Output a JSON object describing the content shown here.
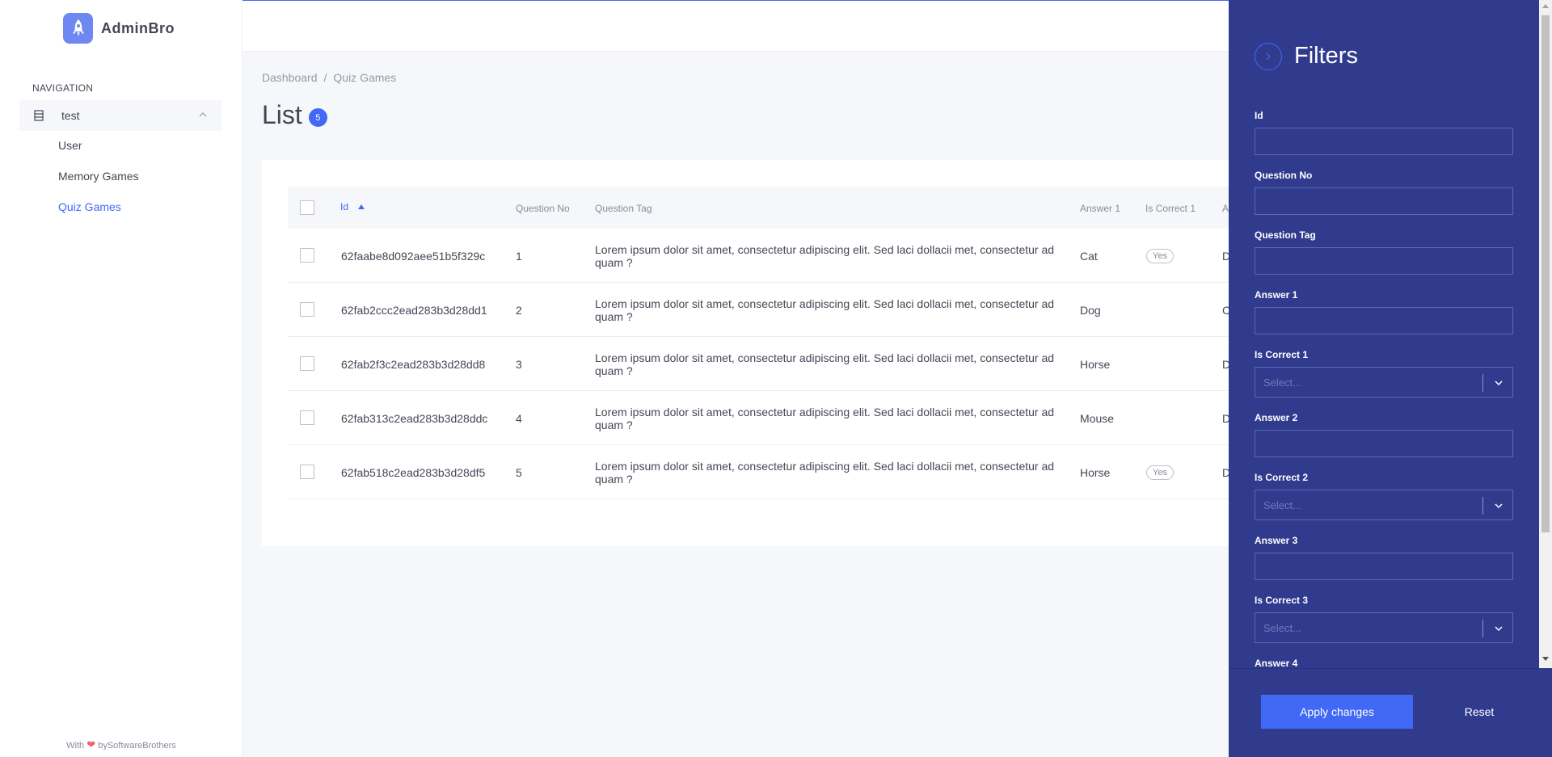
{
  "brand": {
    "name": "AdminBro",
    "logo_icon": "rocket-icon",
    "accent": "#4268F6"
  },
  "sidebar": {
    "heading": "NAVIGATION",
    "parent": {
      "label": "test",
      "icon": "database-icon"
    },
    "items": [
      {
        "label": "User",
        "active": false
      },
      {
        "label": "Memory Games",
        "active": false
      },
      {
        "label": "Quiz Games",
        "active": true
      }
    ],
    "footer": {
      "prefix": "With",
      "heart": "❤",
      "suffix": "bySoftwareBrothers"
    }
  },
  "breadcrumb": {
    "items": [
      "Dashboard",
      "Quiz Games"
    ],
    "separator": "/"
  },
  "page": {
    "title": "List",
    "count": "5"
  },
  "table": {
    "columns": [
      "Id",
      "Question No",
      "Question Tag",
      "Answer 1",
      "Is Correct 1",
      "A"
    ],
    "sort": {
      "column": "Id",
      "direction": "asc"
    },
    "rows": [
      {
        "id": "62faabe8d092aee51b5f329c",
        "question_no": "1",
        "question_tag": "Lorem ipsum dolor sit amet, consectetur adipiscing elit. Sed laci dollacii met, consectetur ad quam ?",
        "answer_1": "Cat",
        "is_correct_1": "Yes",
        "answer_2_partial": "D"
      },
      {
        "id": "62fab2ccc2ead283b3d28dd1",
        "question_no": "2",
        "question_tag": "Lorem ipsum dolor sit amet, consectetur adipiscing elit. Sed laci dollacii met, consectetur ad quam ?",
        "answer_1": "Dog",
        "is_correct_1": "",
        "answer_2_partial": "C"
      },
      {
        "id": "62fab2f3c2ead283b3d28dd8",
        "question_no": "3",
        "question_tag": "Lorem ipsum dolor sit amet, consectetur adipiscing elit. Sed laci dollacii met, consectetur ad quam ?",
        "answer_1": "Horse",
        "is_correct_1": "",
        "answer_2_partial": "D"
      },
      {
        "id": "62fab313c2ead283b3d28ddc",
        "question_no": "4",
        "question_tag": "Lorem ipsum dolor sit amet, consectetur adipiscing elit. Sed laci dollacii met, consectetur ad quam ?",
        "answer_1": "Mouse",
        "is_correct_1": "",
        "answer_2_partial": "D"
      },
      {
        "id": "62fab518c2ead283b3d28df5",
        "question_no": "5",
        "question_tag": "Lorem ipsum dolor sit amet, consectetur adipiscing elit. Sed laci dollacii met, consectetur ad quam ?",
        "answer_1": "Horse",
        "is_correct_1": "Yes",
        "answer_2_partial": "D"
      }
    ]
  },
  "filters": {
    "title": "Filters",
    "fields": [
      {
        "label": "Id",
        "type": "text",
        "value": ""
      },
      {
        "label": "Question No",
        "type": "text",
        "value": ""
      },
      {
        "label": "Question Tag",
        "type": "text",
        "value": ""
      },
      {
        "label": "Answer 1",
        "type": "text",
        "value": ""
      },
      {
        "label": "Is Correct 1",
        "type": "select",
        "placeholder": "Select..."
      },
      {
        "label": "Answer 2",
        "type": "text",
        "value": ""
      },
      {
        "label": "Is Correct 2",
        "type": "select",
        "placeholder": "Select..."
      },
      {
        "label": "Answer 3",
        "type": "text",
        "value": ""
      },
      {
        "label": "Is Correct 3",
        "type": "select",
        "placeholder": "Select..."
      },
      {
        "label": "Answer 4",
        "type": "text",
        "value": ""
      }
    ],
    "apply_label": "Apply changes",
    "reset_label": "Reset",
    "drawer_color": "#303B8E"
  }
}
